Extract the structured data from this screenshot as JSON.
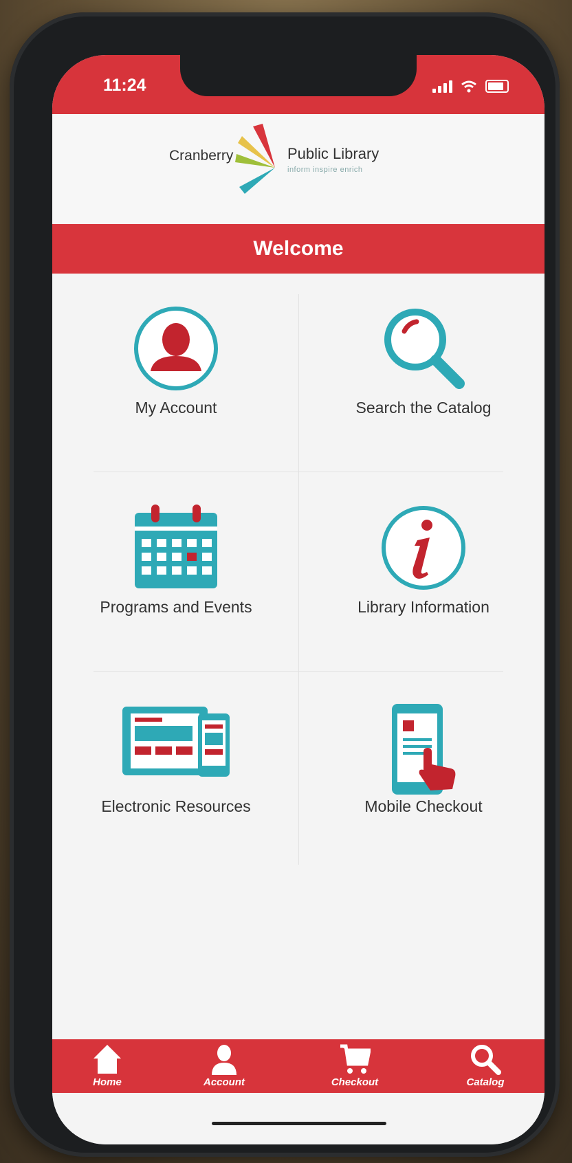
{
  "status_bar": {
    "time": "11:24"
  },
  "logo": {
    "left_text": "Cranberry",
    "right_text": "Public Library",
    "tagline": "inform inspire enrich"
  },
  "banner": {
    "title": "Welcome"
  },
  "tiles": [
    {
      "label": "My Account",
      "icon": "person-icon"
    },
    {
      "label": "Search the Catalog",
      "icon": "magnifier-icon"
    },
    {
      "label": "Programs and Events",
      "icon": "calendar-icon"
    },
    {
      "label": "Library Information",
      "icon": "info-icon"
    },
    {
      "label": "Electronic Resources",
      "icon": "devices-icon"
    },
    {
      "label": "Mobile Checkout",
      "icon": "phone-tap-icon"
    }
  ],
  "tab_bar": [
    {
      "label": "Home",
      "icon": "home-icon"
    },
    {
      "label": "Account",
      "icon": "account-icon"
    },
    {
      "label": "Checkout",
      "icon": "cart-icon"
    },
    {
      "label": "Catalog",
      "icon": "search-icon"
    }
  ],
  "colors": {
    "brand_red": "#d7343b",
    "teal": "#2ea9b6",
    "dark_red": "#c2242e"
  }
}
